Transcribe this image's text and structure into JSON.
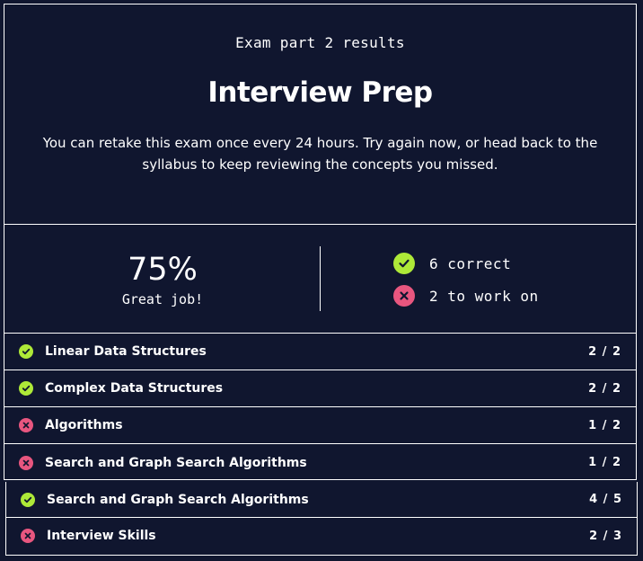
{
  "header": {
    "subtitle": "Exam part 2 results",
    "title": "Interview Prep",
    "description": "You can retake this exam once every 24 hours. Try again now, or head back to the syllabus to keep reviewing the concepts you missed."
  },
  "score": {
    "percent": "75%",
    "label": "Great job!",
    "correct": "6 correct",
    "to_work_on": "2 to work on"
  },
  "colors": {
    "background": "#10162f",
    "correct": "#aee938",
    "incorrect": "#e8567f"
  },
  "topics": [
    {
      "name": "Linear Data Structures",
      "score": "2 / 2",
      "status": "correct"
    },
    {
      "name": "Complex Data Structures",
      "score": "2 / 2",
      "status": "correct"
    },
    {
      "name": "Algorithms",
      "score": "1 / 2",
      "status": "incorrect"
    },
    {
      "name": "Search and Graph Search Algorithms",
      "score": "1 / 2",
      "status": "incorrect"
    }
  ],
  "extra_topics": [
    {
      "name": "Search and Graph Search Algorithms",
      "score": "4 / 5",
      "status": "correct"
    },
    {
      "name": "Interview Skills",
      "score": "2 / 3",
      "status": "incorrect"
    }
  ]
}
